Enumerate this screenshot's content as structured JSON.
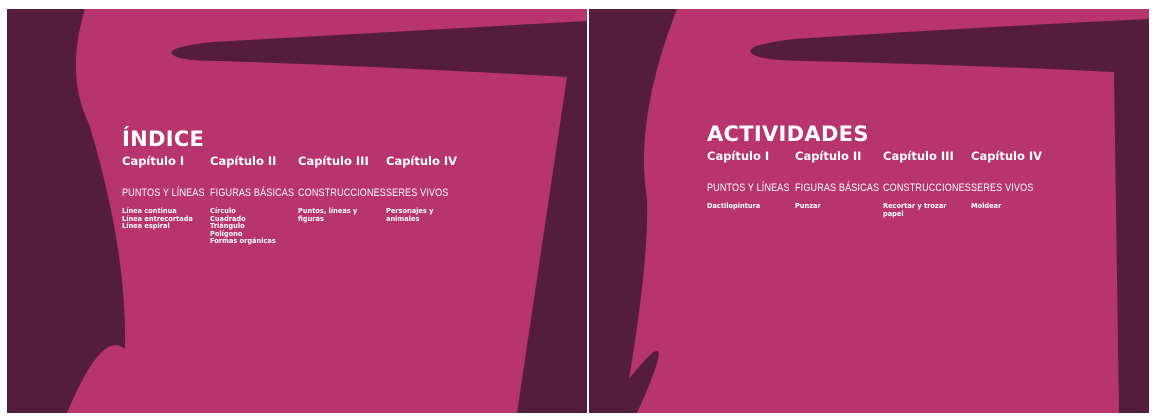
{
  "colors": {
    "dark": "#541d3b",
    "magenta": "#b8346c",
    "text": "#ffffff"
  },
  "left_page": {
    "title": "ÍNDICE",
    "columns": [
      {
        "chapter": "Capítulo I",
        "topic": "PUNTOS Y LÍNEAS",
        "items": [
          "Línea continua",
          "Línea entrecortada",
          "Línea espiral"
        ]
      },
      {
        "chapter": "Capítulo II",
        "topic": "FIGURAS BÁSICAS",
        "items": [
          "Círculo",
          "Cuadrado",
          "Triángulo",
          "Polígono",
          "Formas orgánicas"
        ]
      },
      {
        "chapter": "Capítulo III",
        "topic": "CONSTRUCCIONES",
        "items": [
          "Puntos, líneas y",
          "figuras"
        ]
      },
      {
        "chapter": "Capítulo IV",
        "topic": "SERES VIVOS",
        "items": [
          "Personajes y",
          "animales"
        ]
      }
    ]
  },
  "right_page": {
    "title": "ACTIVIDADES",
    "columns": [
      {
        "chapter": "Capítulo I",
        "topic": "PUNTOS Y LÍNEAS",
        "items": [
          "Dactilopintura"
        ]
      },
      {
        "chapter": "Capítulo II",
        "topic": "FIGURAS BÁSICAS",
        "items": [
          "Punzar"
        ]
      },
      {
        "chapter": "Capítulo III",
        "topic": "CONSTRUCCIONES",
        "items": [
          "Recortar y trozar",
          "papel"
        ]
      },
      {
        "chapter": "Capítulo IV",
        "topic": "SERES VIVOS",
        "items": [
          "Moldear"
        ]
      }
    ]
  }
}
